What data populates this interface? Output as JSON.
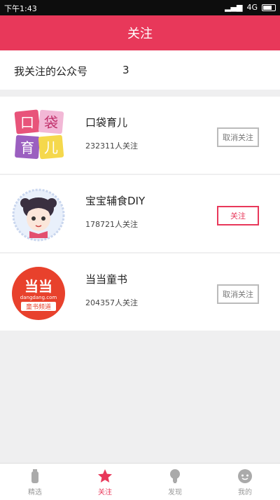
{
  "status_bar": {
    "time": "下午1:43",
    "network": "4G"
  },
  "header": {
    "title": "关注"
  },
  "summary": {
    "label": "我关注的公众号",
    "count": "3"
  },
  "accounts": [
    {
      "name": "口袋育儿",
      "followers": "232311人关注",
      "button": "取消关注",
      "logo_chars": [
        "口",
        "袋",
        "育",
        "儿"
      ]
    },
    {
      "name": "宝宝辅食DIY",
      "followers": "178721人关注",
      "button": "关注"
    },
    {
      "name": "当当童书",
      "followers": "204357人关注",
      "button": "取消关注",
      "logo_text": [
        "当当",
        "dangdang.com",
        "童书频道"
      ]
    }
  ],
  "tabs": [
    {
      "label": "精选",
      "icon": "bottle-icon"
    },
    {
      "label": "关注",
      "icon": "star-icon"
    },
    {
      "label": "发现",
      "icon": "lightbulb-icon"
    },
    {
      "label": "我的",
      "icon": "face-icon"
    }
  ],
  "colors": {
    "accent": "#e8385a",
    "background": "#efeff0"
  }
}
